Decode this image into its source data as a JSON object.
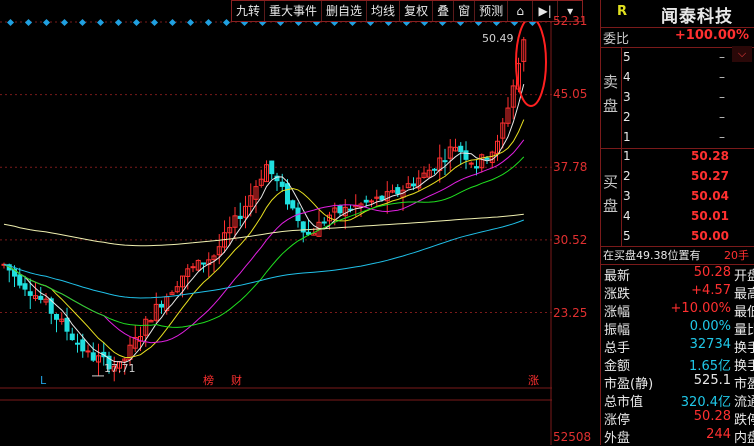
{
  "toolbar": {
    "buttons": [
      "九转",
      "重大事件",
      "删自选",
      "均线",
      "复权",
      "叠",
      "窗",
      "预测"
    ],
    "icons": [
      "home-outline-icon",
      "jump-to-end-icon",
      "dropdown-arrow-icon"
    ]
  },
  "y_axis": {
    "ticks": [
      "52.31",
      "45.05",
      "37.78",
      "30.52",
      "23.25"
    ],
    "volume_label": "52508"
  },
  "price_annotations": {
    "high": "50.49",
    "low": "17.71"
  },
  "markers": {
    "left": "L",
    "bang": "榜",
    "cai": "财",
    "zhang": "涨"
  },
  "chart_data": {
    "type": "candlestick",
    "ylim": [
      16.5,
      52.31
    ],
    "high_label": 50.49,
    "low_label": 17.71,
    "moving_average_colors": [
      "#e8e8e8",
      "#e8e020",
      "#e020e0",
      "#20e020",
      "#20c0e8",
      "#f0f0b0"
    ]
  },
  "colors": {
    "up": "#ff3030",
    "down": "#20e0e0",
    "grid": "#7a1a1a",
    "accent_circle": "#ff2020"
  },
  "panel": {
    "r_label": "R",
    "stock_name": "闻泰科技",
    "ratio_label": "委比",
    "ratio_value": "+100.00%",
    "sell_label": "卖盘",
    "buy_label": "买盘",
    "asks": [
      {
        "level": "5",
        "price": "–"
      },
      {
        "level": "4",
        "price": "–"
      },
      {
        "level": "3",
        "price": "–"
      },
      {
        "level": "2",
        "price": "–"
      },
      {
        "level": "1",
        "price": "–"
      }
    ],
    "bids": [
      {
        "level": "1",
        "price": "50.28"
      },
      {
        "level": "2",
        "price": "50.27"
      },
      {
        "level": "3",
        "price": "50.04"
      },
      {
        "level": "4",
        "price": "50.01"
      },
      {
        "level": "5",
        "price": "50.00"
      }
    ],
    "bid_info": "在买盘49.38位置有",
    "bid_info_count": "20手",
    "stats": [
      {
        "label": "最新",
        "value": "50.28",
        "next": "开盘",
        "cls": ""
      },
      {
        "label": "涨跌",
        "value": "+4.57",
        "next": "最高",
        "cls": ""
      },
      {
        "label": "涨幅",
        "value": "+10.00%",
        "next": "最低",
        "cls": ""
      },
      {
        "label": "振幅",
        "value": "0.00%",
        "next": "量比",
        "cls": "cyan"
      },
      {
        "label": "总手",
        "value": "32734",
        "next": "换手",
        "cls": "cyan"
      },
      {
        "label": "金额",
        "value": "1.65亿",
        "next": "换手",
        "cls": "cyan"
      },
      {
        "label": "市盈(静)",
        "value": "525.1",
        "next": "市盈",
        "cls": "white"
      },
      {
        "label": "总市值",
        "value": "320.4亿",
        "next": "流通",
        "cls": "cyan"
      },
      {
        "label": "涨停",
        "value": "50.28",
        "next": "跌停",
        "cls": ""
      },
      {
        "label": "外盘",
        "value": "244",
        "next": "内盘",
        "cls": ""
      }
    ]
  }
}
